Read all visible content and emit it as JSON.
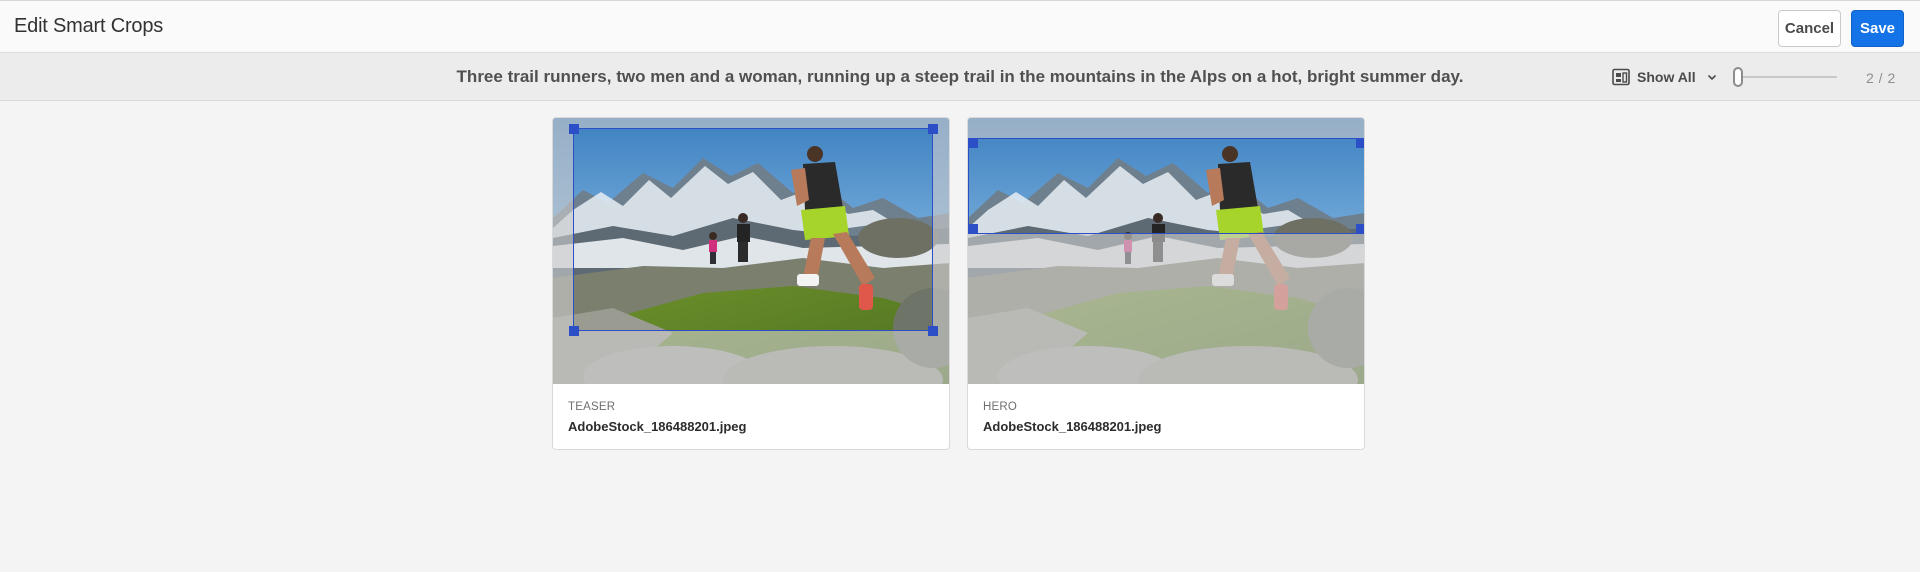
{
  "header": {
    "title": "Edit Smart Crops",
    "cancel_label": "Cancel",
    "save_label": "Save"
  },
  "toolbar": {
    "description": "Three trail runners, two men and a woman, running up a steep trail in the mountains in the Alps on a hot, bright summer day.",
    "view_select": {
      "icon": "card-view-icon",
      "selected": "Show All"
    },
    "size_slider": {
      "value": 0
    },
    "counter": "2 / 2"
  },
  "cards": [
    {
      "type": "TEASER",
      "filename": "AdobeStock_186488201.jpeg"
    },
    {
      "type": "HERO",
      "filename": "AdobeStock_186488201.jpeg"
    }
  ],
  "colors": {
    "accent": "#1473e6",
    "crop_frame": "#2c4ec6"
  }
}
